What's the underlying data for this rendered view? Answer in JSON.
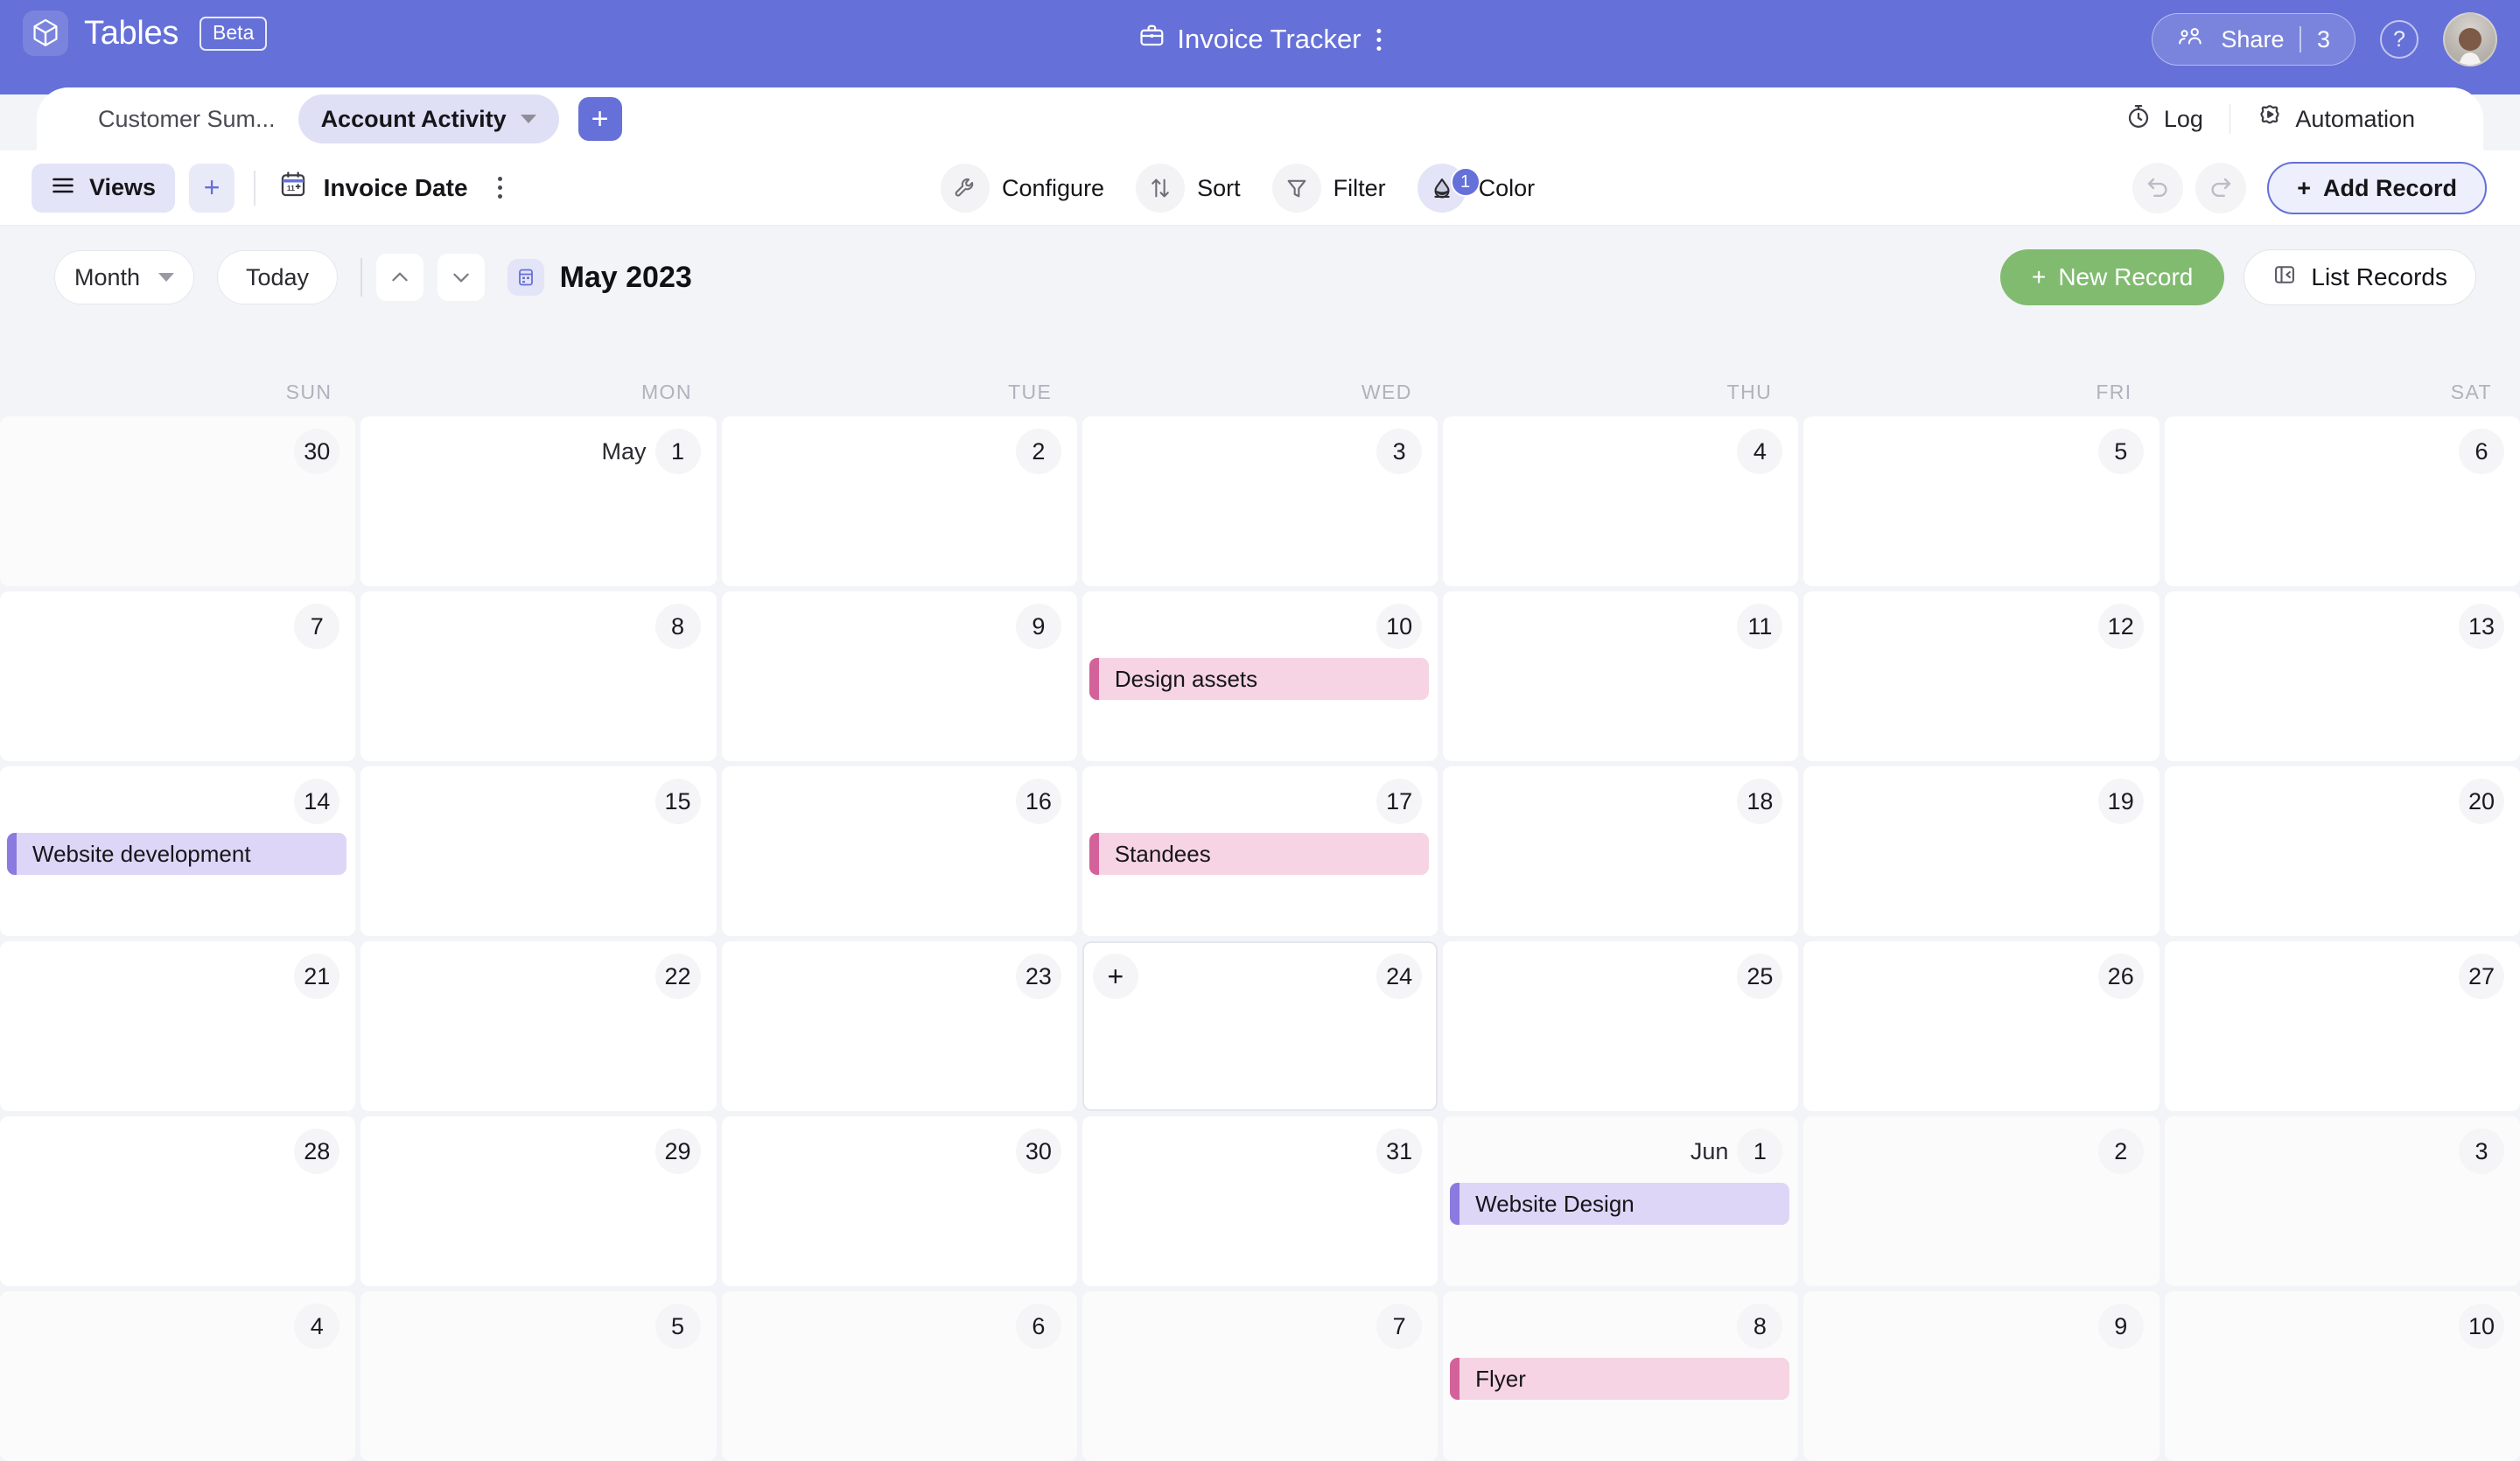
{
  "topbar": {
    "brand_name": "Tables",
    "beta_label": "Beta",
    "logo_icon": "cube-logo-icon",
    "doc_icon": "briefcase-icon",
    "doc_title": "Invoice Tracker",
    "doc_menu_icon": "kebab-menu-icon",
    "share_icon": "people-share-icon",
    "share_label": "Share",
    "share_count": "3",
    "help_icon": "help-circle-icon",
    "help_glyph": "?",
    "avatar_icon": "user-avatar"
  },
  "tabs": {
    "items": [
      {
        "label": "Customer Sum...",
        "active": false
      },
      {
        "label": "Account Activity",
        "active": true
      }
    ],
    "add_tab_icon": "plus-icon",
    "add_tab_label": "+",
    "log_icon": "stopwatch-icon",
    "log_label": "Log",
    "automation_icon": "automation-gear-icon",
    "automation_label": "Automation"
  },
  "toolbar": {
    "views_icon": "hamburger-icon",
    "views_label": "Views",
    "add_view_label": "+",
    "field_icon": "calendar-icon",
    "field_label": "Invoice Date",
    "field_menu_icon": "kebab-menu-icon",
    "configure_icon": "wrench-icon",
    "configure_label": "Configure",
    "sort_icon": "sort-arrows-icon",
    "sort_label": "Sort",
    "filter_icon": "funnel-icon",
    "filter_label": "Filter",
    "color_icon": "paint-drop-icon",
    "color_label": "Color",
    "color_badge": "1",
    "undo_icon": "undo-arrow-icon",
    "redo_icon": "redo-arrow-icon",
    "add_record_label": "Add Record",
    "add_record_plus": "+"
  },
  "calendar_bar": {
    "view_mode": "Month",
    "today_label": "Today",
    "prev_icon": "chevron-up-icon",
    "next_icon": "chevron-down-icon",
    "month_icon": "calendar-month-icon",
    "month_title": "May 2023",
    "new_record_label": "New Record",
    "new_record_plus": "+",
    "list_records_icon": "panel-collapse-icon",
    "list_records_label": "List Records"
  },
  "calendar": {
    "day_headers": [
      "SUN",
      "MON",
      "TUE",
      "WED",
      "THU",
      "FRI",
      "SAT"
    ],
    "weeks": [
      [
        {
          "day": "30",
          "month_prefix": "",
          "out_of_month": true,
          "hover": false,
          "events": []
        },
        {
          "day": "1",
          "month_prefix": "May",
          "out_of_month": false,
          "hover": false,
          "events": []
        },
        {
          "day": "2",
          "month_prefix": "",
          "out_of_month": false,
          "hover": false,
          "events": []
        },
        {
          "day": "3",
          "month_prefix": "",
          "out_of_month": false,
          "hover": false,
          "events": []
        },
        {
          "day": "4",
          "month_prefix": "",
          "out_of_month": false,
          "hover": false,
          "events": []
        },
        {
          "day": "5",
          "month_prefix": "",
          "out_of_month": false,
          "hover": false,
          "events": []
        },
        {
          "day": "6",
          "month_prefix": "",
          "out_of_month": false,
          "hover": false,
          "events": []
        }
      ],
      [
        {
          "day": "7",
          "month_prefix": "",
          "out_of_month": false,
          "hover": false,
          "events": []
        },
        {
          "day": "8",
          "month_prefix": "",
          "out_of_month": false,
          "hover": false,
          "events": []
        },
        {
          "day": "9",
          "month_prefix": "",
          "out_of_month": false,
          "hover": false,
          "events": []
        },
        {
          "day": "10",
          "month_prefix": "",
          "out_of_month": false,
          "hover": false,
          "events": [
            {
              "title": "Design assets",
              "color": "pink"
            }
          ]
        },
        {
          "day": "11",
          "month_prefix": "",
          "out_of_month": false,
          "hover": false,
          "events": []
        },
        {
          "day": "12",
          "month_prefix": "",
          "out_of_month": false,
          "hover": false,
          "events": []
        },
        {
          "day": "13",
          "month_prefix": "",
          "out_of_month": false,
          "hover": false,
          "events": []
        }
      ],
      [
        {
          "day": "14",
          "month_prefix": "",
          "out_of_month": false,
          "hover": false,
          "events": [
            {
              "title": "Website development",
              "color": "purple"
            }
          ]
        },
        {
          "day": "15",
          "month_prefix": "",
          "out_of_month": false,
          "hover": false,
          "events": []
        },
        {
          "day": "16",
          "month_prefix": "",
          "out_of_month": false,
          "hover": false,
          "events": []
        },
        {
          "day": "17",
          "month_prefix": "",
          "out_of_month": false,
          "hover": false,
          "events": [
            {
              "title": "Standees",
              "color": "pink"
            }
          ]
        },
        {
          "day": "18",
          "month_prefix": "",
          "out_of_month": false,
          "hover": false,
          "events": []
        },
        {
          "day": "19",
          "month_prefix": "",
          "out_of_month": false,
          "hover": false,
          "events": []
        },
        {
          "day": "20",
          "month_prefix": "",
          "out_of_month": false,
          "hover": false,
          "events": []
        }
      ],
      [
        {
          "day": "21",
          "month_prefix": "",
          "out_of_month": false,
          "hover": false,
          "events": []
        },
        {
          "day": "22",
          "month_prefix": "",
          "out_of_month": false,
          "hover": false,
          "events": []
        },
        {
          "day": "23",
          "month_prefix": "",
          "out_of_month": false,
          "hover": false,
          "events": []
        },
        {
          "day": "24",
          "month_prefix": "",
          "out_of_month": false,
          "hover": true,
          "events": []
        },
        {
          "day": "25",
          "month_prefix": "",
          "out_of_month": false,
          "hover": false,
          "events": []
        },
        {
          "day": "26",
          "month_prefix": "",
          "out_of_month": false,
          "hover": false,
          "events": []
        },
        {
          "day": "27",
          "month_prefix": "",
          "out_of_month": false,
          "hover": false,
          "events": []
        }
      ],
      [
        {
          "day": "28",
          "month_prefix": "",
          "out_of_month": false,
          "hover": false,
          "events": []
        },
        {
          "day": "29",
          "month_prefix": "",
          "out_of_month": false,
          "hover": false,
          "events": []
        },
        {
          "day": "30",
          "month_prefix": "",
          "out_of_month": false,
          "hover": false,
          "events": []
        },
        {
          "day": "31",
          "month_prefix": "",
          "out_of_month": false,
          "hover": false,
          "events": []
        },
        {
          "day": "1",
          "month_prefix": "Jun",
          "out_of_month": true,
          "hover": false,
          "events": [
            {
              "title": "Website Design",
              "color": "purple"
            }
          ]
        },
        {
          "day": "2",
          "month_prefix": "",
          "out_of_month": true,
          "hover": false,
          "events": []
        },
        {
          "day": "3",
          "month_prefix": "",
          "out_of_month": true,
          "hover": false,
          "events": []
        }
      ],
      [
        {
          "day": "4",
          "month_prefix": "",
          "out_of_month": true,
          "hover": false,
          "events": []
        },
        {
          "day": "5",
          "month_prefix": "",
          "out_of_month": true,
          "hover": false,
          "events": []
        },
        {
          "day": "6",
          "month_prefix": "",
          "out_of_month": true,
          "hover": false,
          "events": []
        },
        {
          "day": "7",
          "month_prefix": "",
          "out_of_month": true,
          "hover": false,
          "events": []
        },
        {
          "day": "8",
          "month_prefix": "",
          "out_of_month": true,
          "hover": false,
          "events": [
            {
              "title": "Flyer",
              "color": "pink"
            }
          ]
        },
        {
          "day": "9",
          "month_prefix": "",
          "out_of_month": true,
          "hover": false,
          "events": []
        },
        {
          "day": "10",
          "month_prefix": "",
          "out_of_month": true,
          "hover": false,
          "events": []
        }
      ]
    ]
  },
  "colors": {
    "brand_purple": "#6570d8",
    "accent_green": "#81bb70",
    "chip_pink_bg": "#f6d4e3",
    "chip_pink_bar": "#d4629a",
    "chip_purple_bg": "#ddd6f7",
    "chip_purple_bar": "#8b7ae0",
    "page_bg": "#f3f4f8"
  }
}
